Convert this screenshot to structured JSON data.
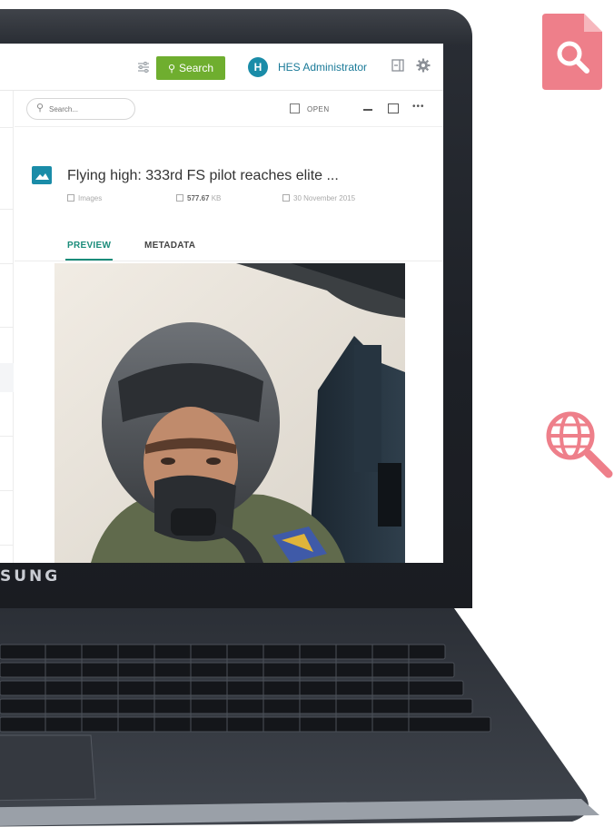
{
  "header": {
    "search_label": "Search",
    "user_initial": "H",
    "user_name": "HES Administrator"
  },
  "toolbar": {
    "search_placeholder": "Search...",
    "open_label": "OPEN"
  },
  "document": {
    "title": "Flying high: 333rd FS pilot reaches elite ...",
    "category": "Images",
    "size_value": "577.67",
    "size_unit": "KB",
    "date": "30 November 2015"
  },
  "tabs": [
    {
      "label": "PREVIEW"
    },
    {
      "label": "METADATA"
    }
  ],
  "device": {
    "brand_text": "SUNG"
  },
  "colors": {
    "accent_green": "#6fae2f",
    "brand_teal": "#1a8ca8",
    "tab_active": "#1a8c7a",
    "deco_pink": "#ee7f8a"
  },
  "icons": {
    "deco_top": "document-search-icon",
    "deco_mid": "globe-search-icon"
  }
}
